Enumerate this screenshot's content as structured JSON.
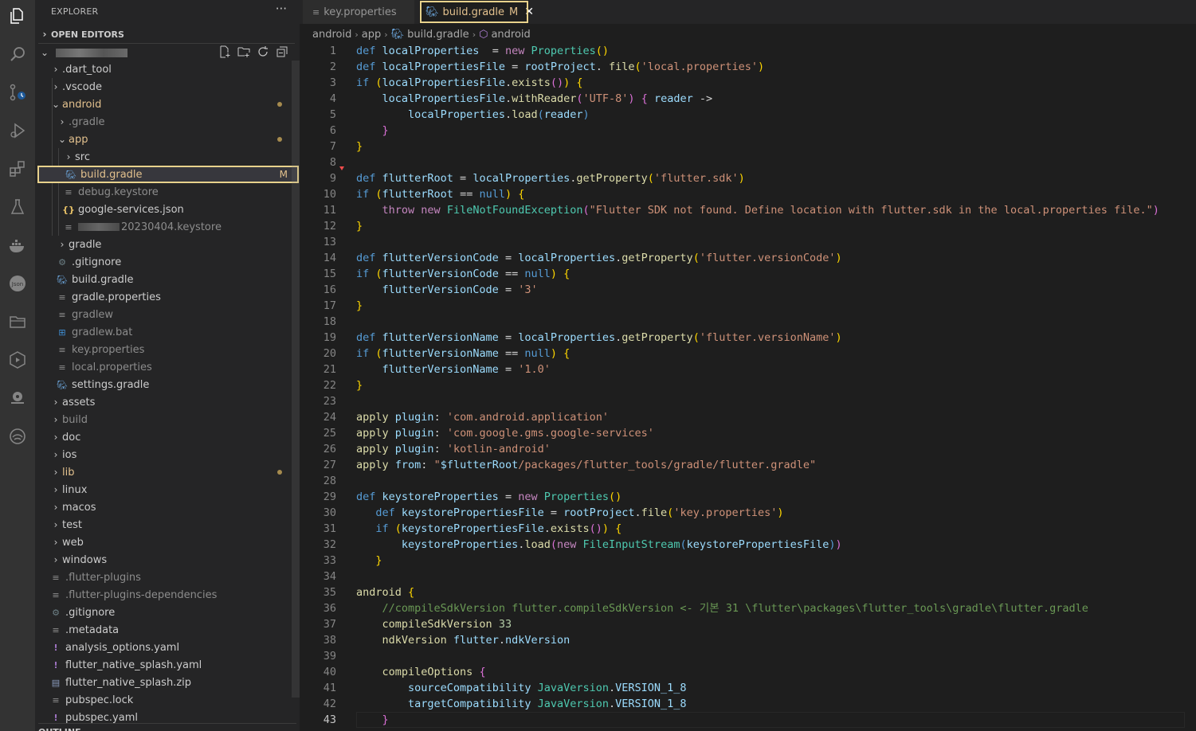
{
  "activity_bar": [
    {
      "name": "explorer-icon"
    },
    {
      "name": "search-icon"
    },
    {
      "name": "source-control-icon"
    },
    {
      "name": "run-debug-icon"
    },
    {
      "name": "extensions-icon"
    },
    {
      "name": "testing-icon"
    },
    {
      "name": "docker-icon"
    },
    {
      "name": "json-icon"
    },
    {
      "name": "folder-icon"
    },
    {
      "name": "deploy-icon"
    },
    {
      "name": "remote-icon"
    },
    {
      "name": "wave-icon"
    }
  ],
  "sidebar": {
    "title": "EXPLORER",
    "more": "···",
    "open_editors": "OPEN EDITORS",
    "tree": [
      {
        "label": ".dart_tool",
        "type": "folder",
        "depth": 0,
        "state": "closed",
        "dim": false
      },
      {
        "label": ".vscode",
        "type": "folder",
        "depth": 0,
        "state": "closed",
        "dim": false
      },
      {
        "label": "android",
        "type": "folder",
        "depth": 0,
        "state": "open",
        "mod": true,
        "dot": true
      },
      {
        "label": ".gradle",
        "type": "folder",
        "depth": 1,
        "state": "closed",
        "dim": true
      },
      {
        "label": "app",
        "type": "folder",
        "depth": 1,
        "state": "open",
        "mod": true,
        "dot": true
      },
      {
        "label": "src",
        "type": "folder",
        "depth": 2,
        "state": "closed"
      },
      {
        "label": "build.gradle",
        "type": "gradle",
        "depth": 2,
        "mod": true,
        "flag": "M",
        "selected": true
      },
      {
        "label": "debug.keystore",
        "type": "lines",
        "depth": 2,
        "dim": true
      },
      {
        "label": "google-services.json",
        "type": "json",
        "depth": 2
      },
      {
        "label": "20230404.keystore",
        "type": "lines",
        "depth": 2,
        "dim": true,
        "blurred": true
      },
      {
        "label": "gradle",
        "type": "folder",
        "depth": 1,
        "state": "closed"
      },
      {
        "label": ".gitignore",
        "type": "gear",
        "depth": 1
      },
      {
        "label": "build.gradle",
        "type": "gradle",
        "depth": 1
      },
      {
        "label": "gradle.properties",
        "type": "lines",
        "depth": 1
      },
      {
        "label": "gradlew",
        "type": "lines",
        "depth": 1,
        "dim": true
      },
      {
        "label": "gradlew.bat",
        "type": "win",
        "depth": 1,
        "dim": true
      },
      {
        "label": "key.properties",
        "type": "lines",
        "depth": 1,
        "dim": true
      },
      {
        "label": "local.properties",
        "type": "lines",
        "depth": 1,
        "dim": true
      },
      {
        "label": "settings.gradle",
        "type": "gradle",
        "depth": 1
      },
      {
        "label": "assets",
        "type": "folder",
        "depth": 0,
        "state": "closed"
      },
      {
        "label": "build",
        "type": "folder",
        "depth": 0,
        "state": "closed",
        "dim": true
      },
      {
        "label": "doc",
        "type": "folder",
        "depth": 0,
        "state": "closed"
      },
      {
        "label": "ios",
        "type": "folder",
        "depth": 0,
        "state": "closed"
      },
      {
        "label": "lib",
        "type": "folder",
        "depth": 0,
        "state": "closed",
        "mod": true,
        "dot": true
      },
      {
        "label": "linux",
        "type": "folder",
        "depth": 0,
        "state": "closed"
      },
      {
        "label": "macos",
        "type": "folder",
        "depth": 0,
        "state": "closed"
      },
      {
        "label": "test",
        "type": "folder",
        "depth": 0,
        "state": "closed"
      },
      {
        "label": "web",
        "type": "folder",
        "depth": 0,
        "state": "closed"
      },
      {
        "label": "windows",
        "type": "folder",
        "depth": 0,
        "state": "closed"
      },
      {
        "label": ".flutter-plugins",
        "type": "lines",
        "depth": 0,
        "dim": true
      },
      {
        "label": ".flutter-plugins-dependencies",
        "type": "lines",
        "depth": 0,
        "dim": true
      },
      {
        "label": ".gitignore",
        "type": "gear",
        "depth": 0
      },
      {
        "label": ".metadata",
        "type": "lines",
        "depth": 0
      },
      {
        "label": "analysis_options.yaml",
        "type": "yaml",
        "depth": 0
      },
      {
        "label": "flutter_native_splash.yaml",
        "type": "yaml",
        "depth": 0
      },
      {
        "label": "flutter_native_splash.zip",
        "type": "zip",
        "depth": 0
      },
      {
        "label": "pubspec.lock",
        "type": "lines",
        "depth": 0
      },
      {
        "label": "pubspec.yaml",
        "type": "yaml",
        "depth": 0
      }
    ],
    "outline": "OUTLINE"
  },
  "tabs": [
    {
      "label": "key.properties"
    },
    {
      "label": "build.gradle",
      "flag": "M",
      "close": "✕"
    }
  ],
  "breadcrumb": [
    "android",
    "app",
    "build.gradle",
    "android"
  ],
  "editor": {
    "current_line": 43,
    "lines": [
      [
        [
          "k",
          "def "
        ],
        [
          "v",
          "localProperties"
        ],
        [
          "",
          "  = "
        ],
        [
          "c",
          "new "
        ],
        [
          "t",
          "Properties"
        ],
        [
          "p",
          "()"
        ]
      ],
      [
        [
          "k",
          "def "
        ],
        [
          "v",
          "localPropertiesFile"
        ],
        [
          "",
          " = "
        ],
        [
          "v",
          "rootProject"
        ],
        [
          "",
          ". "
        ],
        [
          "f",
          "file"
        ],
        [
          "p",
          "("
        ],
        [
          "s",
          "'local.properties'"
        ],
        [
          "p",
          ")"
        ]
      ],
      [
        [
          "k",
          "if "
        ],
        [
          "p",
          "("
        ],
        [
          "v",
          "localPropertiesFile"
        ],
        [
          "",
          "."
        ],
        [
          "f",
          "exists"
        ],
        [
          "q",
          "()"
        ],
        [
          "p",
          ") {"
        ]
      ],
      [
        [
          "",
          "    "
        ],
        [
          "v",
          "localPropertiesFile"
        ],
        [
          "",
          "."
        ],
        [
          "f",
          "withReader"
        ],
        [
          "q",
          "("
        ],
        [
          "s",
          "'UTF-8'"
        ],
        [
          "q",
          ")"
        ],
        [
          "",
          " "
        ],
        [
          "q",
          "{"
        ],
        [
          "",
          " "
        ],
        [
          "v",
          "reader"
        ],
        [
          "",
          " ->"
        ]
      ],
      [
        [
          "",
          "        "
        ],
        [
          "v",
          "localProperties"
        ],
        [
          "",
          "."
        ],
        [
          "f",
          "load"
        ],
        [
          "k",
          "("
        ],
        [
          "v",
          "reader"
        ],
        [
          "k",
          ")"
        ]
      ],
      [
        [
          "",
          "    "
        ],
        [
          "q",
          "}"
        ]
      ],
      [
        [
          "p",
          "}"
        ]
      ],
      [
        [
          "",
          ""
        ]
      ],
      [
        [
          "k",
          "def "
        ],
        [
          "v",
          "flutterRoot"
        ],
        [
          "",
          " = "
        ],
        [
          "v",
          "localProperties"
        ],
        [
          "",
          "."
        ],
        [
          "f",
          "getProperty"
        ],
        [
          "p",
          "("
        ],
        [
          "s",
          "'flutter.sdk'"
        ],
        [
          "p",
          ")"
        ]
      ],
      [
        [
          "k",
          "if "
        ],
        [
          "p",
          "("
        ],
        [
          "v",
          "flutterRoot"
        ],
        [
          "",
          " == "
        ],
        [
          "k",
          "null"
        ],
        [
          "p",
          ") {"
        ]
      ],
      [
        [
          "",
          "    "
        ],
        [
          "c",
          "throw "
        ],
        [
          "c",
          "new "
        ],
        [
          "t",
          "FileNotFoundException"
        ],
        [
          "q",
          "("
        ],
        [
          "s",
          "\"Flutter SDK not found. Define location with flutter.sdk in the local.properties file.\""
        ],
        [
          "q",
          ")"
        ]
      ],
      [
        [
          "p",
          "}"
        ]
      ],
      [
        [
          "",
          ""
        ]
      ],
      [
        [
          "k",
          "def "
        ],
        [
          "v",
          "flutterVersionCode"
        ],
        [
          "",
          " = "
        ],
        [
          "v",
          "localProperties"
        ],
        [
          "",
          "."
        ],
        [
          "f",
          "getProperty"
        ],
        [
          "p",
          "("
        ],
        [
          "s",
          "'flutter.versionCode'"
        ],
        [
          "p",
          ")"
        ]
      ],
      [
        [
          "k",
          "if "
        ],
        [
          "p",
          "("
        ],
        [
          "v",
          "flutterVersionCode"
        ],
        [
          "",
          " == "
        ],
        [
          "k",
          "null"
        ],
        [
          "p",
          ") {"
        ]
      ],
      [
        [
          "",
          "    "
        ],
        [
          "v",
          "flutterVersionCode"
        ],
        [
          "",
          " = "
        ],
        [
          "s",
          "'3'"
        ]
      ],
      [
        [
          "p",
          "}"
        ]
      ],
      [
        [
          "",
          ""
        ]
      ],
      [
        [
          "k",
          "def "
        ],
        [
          "v",
          "flutterVersionName"
        ],
        [
          "",
          " = "
        ],
        [
          "v",
          "localProperties"
        ],
        [
          "",
          "."
        ],
        [
          "f",
          "getProperty"
        ],
        [
          "p",
          "("
        ],
        [
          "s",
          "'flutter.versionName'"
        ],
        [
          "p",
          ")"
        ]
      ],
      [
        [
          "k",
          "if "
        ],
        [
          "p",
          "("
        ],
        [
          "v",
          "flutterVersionName"
        ],
        [
          "",
          " == "
        ],
        [
          "k",
          "null"
        ],
        [
          "p",
          ") {"
        ]
      ],
      [
        [
          "",
          "    "
        ],
        [
          "v",
          "flutterVersionName"
        ],
        [
          "",
          " = "
        ],
        [
          "s",
          "'1.0'"
        ]
      ],
      [
        [
          "p",
          "}"
        ]
      ],
      [
        [
          "",
          ""
        ]
      ],
      [
        [
          "f",
          "apply "
        ],
        [
          "v",
          "plugin"
        ],
        [
          "",
          ": "
        ],
        [
          "s",
          "'com.android.application'"
        ]
      ],
      [
        [
          "f",
          "apply "
        ],
        [
          "v",
          "plugin"
        ],
        [
          "",
          ": "
        ],
        [
          "s",
          "'com.google.gms.google-services'"
        ]
      ],
      [
        [
          "f",
          "apply "
        ],
        [
          "v",
          "plugin"
        ],
        [
          "",
          ": "
        ],
        [
          "s",
          "'kotlin-android'"
        ]
      ],
      [
        [
          "f",
          "apply "
        ],
        [
          "v",
          "from"
        ],
        [
          "",
          ": "
        ],
        [
          "s",
          "\""
        ],
        [
          "v",
          "$flutterRoot"
        ],
        [
          "s",
          "/packages/flutter_tools/gradle/flutter.gradle\""
        ]
      ],
      [
        [
          "",
          ""
        ]
      ],
      [
        [
          "k",
          "def "
        ],
        [
          "v",
          "keystoreProperties"
        ],
        [
          "",
          " = "
        ],
        [
          "c",
          "new "
        ],
        [
          "t",
          "Properties"
        ],
        [
          "p",
          "()"
        ]
      ],
      [
        [
          "",
          "   "
        ],
        [
          "k",
          "def "
        ],
        [
          "v",
          "keystorePropertiesFile"
        ],
        [
          "",
          " = "
        ],
        [
          "v",
          "rootProject"
        ],
        [
          "",
          "."
        ],
        [
          "f",
          "file"
        ],
        [
          "p",
          "("
        ],
        [
          "s",
          "'key.properties'"
        ],
        [
          "p",
          ")"
        ]
      ],
      [
        [
          "",
          "   "
        ],
        [
          "k",
          "if "
        ],
        [
          "p",
          "("
        ],
        [
          "v",
          "keystorePropertiesFile"
        ],
        [
          "",
          "."
        ],
        [
          "f",
          "exists"
        ],
        [
          "q",
          "()"
        ],
        [
          "p",
          ") {"
        ]
      ],
      [
        [
          "",
          "       "
        ],
        [
          "v",
          "keystoreProperties"
        ],
        [
          "",
          "."
        ],
        [
          "f",
          "load"
        ],
        [
          "q",
          "("
        ],
        [
          "c",
          "new "
        ],
        [
          "t",
          "FileInputStream"
        ],
        [
          "k",
          "("
        ],
        [
          "v",
          "keystorePropertiesFile"
        ],
        [
          "k",
          ")"
        ],
        [
          "q",
          ")"
        ]
      ],
      [
        [
          "",
          "   "
        ],
        [
          "p",
          "}"
        ]
      ],
      [
        [
          "",
          ""
        ]
      ],
      [
        [
          "f",
          "android "
        ],
        [
          "p",
          "{"
        ]
      ],
      [
        [
          "",
          "    "
        ],
        [
          "m",
          "//compileSdkVersion flutter.compileSdkVersion <- 기본 31 \\flutter\\packages\\flutter_tools\\gradle\\flutter.gradle"
        ]
      ],
      [
        [
          "",
          "    "
        ],
        [
          "f",
          "compileSdkVersion "
        ],
        [
          "n",
          "33"
        ]
      ],
      [
        [
          "",
          "    "
        ],
        [
          "f",
          "ndkVersion "
        ],
        [
          "v",
          "flutter"
        ],
        [
          "",
          "."
        ],
        [
          "v",
          "ndkVersion"
        ]
      ],
      [
        [
          "",
          ""
        ]
      ],
      [
        [
          "",
          "    "
        ],
        [
          "f",
          "compileOptions "
        ],
        [
          "q",
          "{"
        ]
      ],
      [
        [
          "",
          "        "
        ],
        [
          "v",
          "sourceCompatibility "
        ],
        [
          "t",
          "JavaVersion"
        ],
        [
          "",
          "."
        ],
        [
          "v",
          "VERSION_1_8"
        ]
      ],
      [
        [
          "",
          "        "
        ],
        [
          "v",
          "targetCompatibility "
        ],
        [
          "t",
          "JavaVersion"
        ],
        [
          "",
          "."
        ],
        [
          "v",
          "VERSION_1_8"
        ]
      ],
      [
        [
          "",
          "    "
        ],
        [
          "q",
          "}"
        ]
      ]
    ]
  }
}
